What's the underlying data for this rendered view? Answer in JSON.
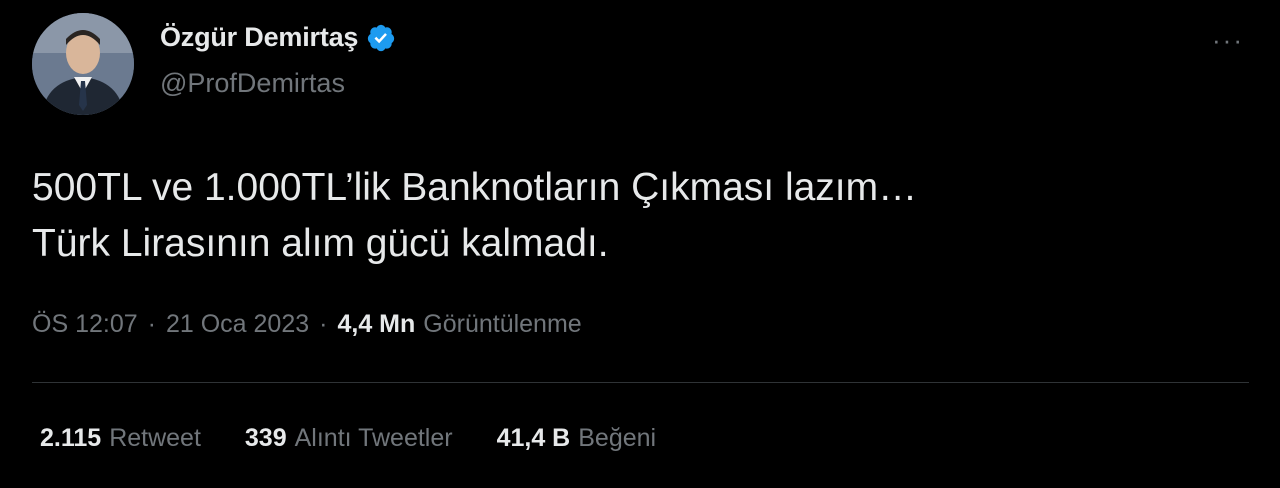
{
  "author": {
    "display_name": "Özgür Demirtaş",
    "handle": "@ProfDemirtas",
    "verified_color": "#1d9bf0"
  },
  "menu": {
    "more_label": "···"
  },
  "tweet": {
    "lines": [
      "500TL ve 1.000TL’lik Banknotların Çıkması lazım…",
      "Türk Lirasının alım gücü kalmadı."
    ]
  },
  "meta": {
    "time": "ÖS 12:07",
    "separator": "·",
    "date": "21 Oca 2023",
    "views_count": "4,4 Mn",
    "views_label": "Görüntülenme"
  },
  "stats": [
    {
      "count": "2.115",
      "label": "Retweet"
    },
    {
      "count": "339",
      "label": "Alıntı Tweetler"
    },
    {
      "count": "41,4 B",
      "label": "Beğeni"
    }
  ]
}
